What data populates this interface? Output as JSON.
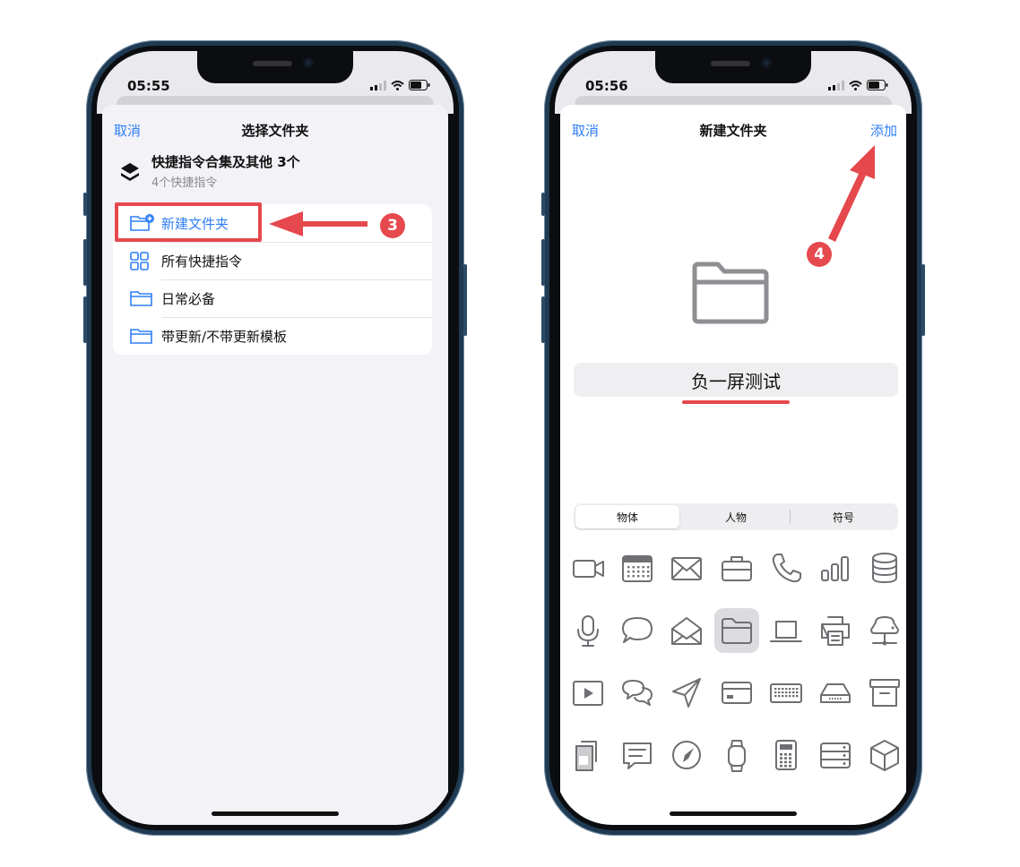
{
  "colors": {
    "accent": "#2f7ef6",
    "annotation_red": "#e5484d",
    "sheet_gray": "#f2f2f7"
  },
  "left": {
    "status_time": "05:55",
    "cancel_label": "取消",
    "title": "选择文件夹",
    "shortcut_name": "快捷指令合集及其他 3个",
    "shortcut_sub": "4个快捷指令",
    "rows": [
      {
        "label": "新建文件夹",
        "icon": "folder-plus-icon"
      },
      {
        "label": "所有快捷指令",
        "icon": "grid-icon"
      },
      {
        "label": "日常必备",
        "icon": "folder-icon"
      },
      {
        "label": "带更新/不带更新模板",
        "icon": "folder-icon"
      }
    ],
    "step_badge": "3"
  },
  "right": {
    "status_time": "05:56",
    "cancel_label": "取消",
    "title": "新建文件夹",
    "add_label": "添加",
    "folder_name": "负一屏测试",
    "step_badge": "4",
    "segments": [
      "物体",
      "人物",
      "符号"
    ],
    "selected_segment": "物体",
    "icon_grid": [
      [
        "video-camera-icon",
        "calendar-icon",
        "envelope-icon",
        "briefcase-icon",
        "phone-icon",
        "bar-chart-icon",
        "database-icon"
      ],
      [
        "microphone-icon",
        "speech-bubble-icon",
        "open-envelope-icon",
        "folder-icon",
        "laptop-icon",
        "printer-icon",
        "network-drive-icon"
      ],
      [
        "play-box-icon",
        "chat-bubbles-icon",
        "paper-plane-icon",
        "credit-card-icon",
        "keyboard-icon",
        "hard-drive-icon",
        "archive-box-icon"
      ],
      [
        "clipboard-stack-icon",
        "message-lines-icon",
        "compass-icon",
        "watch-icon",
        "calculator-icon",
        "server-icon",
        "cube-icon"
      ]
    ],
    "selected_icon": "folder-icon"
  }
}
